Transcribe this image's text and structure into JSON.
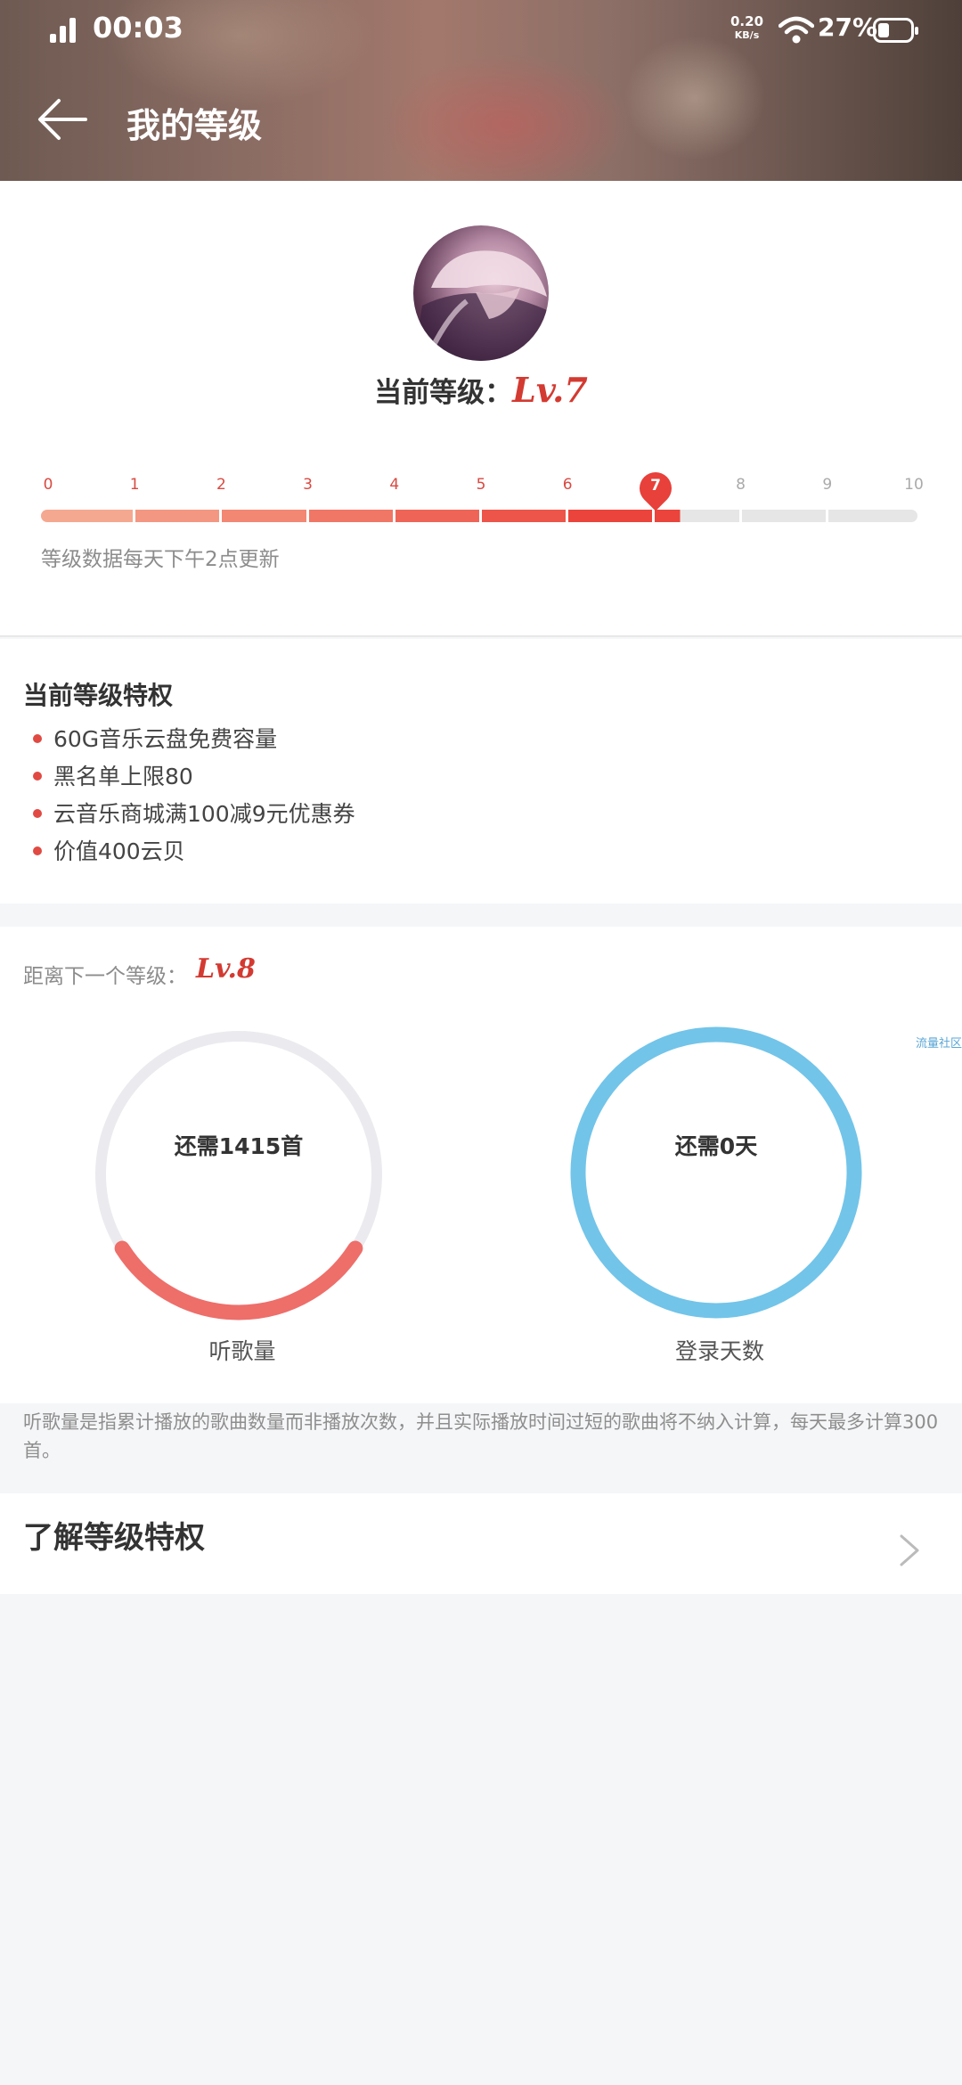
{
  "status_bar": {
    "time": "00:03",
    "net_speed_value": "0.20",
    "net_speed_unit": "KB/s",
    "battery": "27%"
  },
  "header": {
    "title": "我的等级"
  },
  "level": {
    "current_label": "当前等级：",
    "current_value": "Lv.7",
    "current_level_number": 7,
    "ticks": [
      "0",
      "1",
      "2",
      "3",
      "4",
      "5",
      "6",
      "7",
      "8",
      "9",
      "10"
    ],
    "marker": "7",
    "update_note": "等级数据每天下午2点更新"
  },
  "privileges": {
    "title": "当前等级特权",
    "items": [
      "60G音乐云盘免费容量",
      "黑名单上限80",
      "云音乐商城满100减9元优惠券",
      "价值400云贝"
    ]
  },
  "next_level": {
    "label": "距离下一个等级：",
    "value": "Lv.8",
    "side_label": "流量社区",
    "songs": {
      "remaining_text": "还需1415首",
      "caption": "听歌量",
      "progress": 0.32
    },
    "days": {
      "remaining_text": "还需0天",
      "caption": "登录天数",
      "progress": 1.0
    }
  },
  "footnote": "听歌量是指累计播放的歌曲数量而非播放次数，并且实际播放时间过短的歌曲将不纳入计算，每天最多计算300首。",
  "learn_more": {
    "label": "了解等级特权"
  },
  "colors": {
    "accent": "#d33a31",
    "ring_songs": "#ee6e6a",
    "ring_days": "#72c4e9",
    "ring_track": "#ebebef"
  }
}
